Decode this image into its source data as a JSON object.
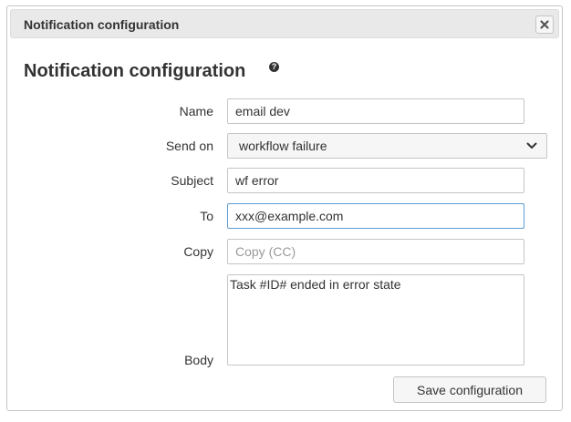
{
  "dialog": {
    "title": "Notification configuration",
    "close_icon": "close-icon"
  },
  "form": {
    "heading": "Notification configuration",
    "help_icon": "help-icon",
    "help_glyph": "?",
    "name": {
      "label": "Name",
      "value": "email dev"
    },
    "send_on": {
      "label": "Send on",
      "selected": "workflow failure"
    },
    "subject": {
      "label": "Subject",
      "value": "wf error"
    },
    "to": {
      "label": "To",
      "value": "xxx@example.com"
    },
    "copy": {
      "label": "Copy",
      "value": "",
      "placeholder": "Copy (CC)"
    },
    "body": {
      "label": "Body",
      "value": "Task #ID# ended in error state"
    },
    "save_label": "Save configuration"
  },
  "colors": {
    "focus_border": "#5b9bd5",
    "titlebar_bg": "#e9e9e9",
    "button_bg": "#f6f6f6"
  }
}
